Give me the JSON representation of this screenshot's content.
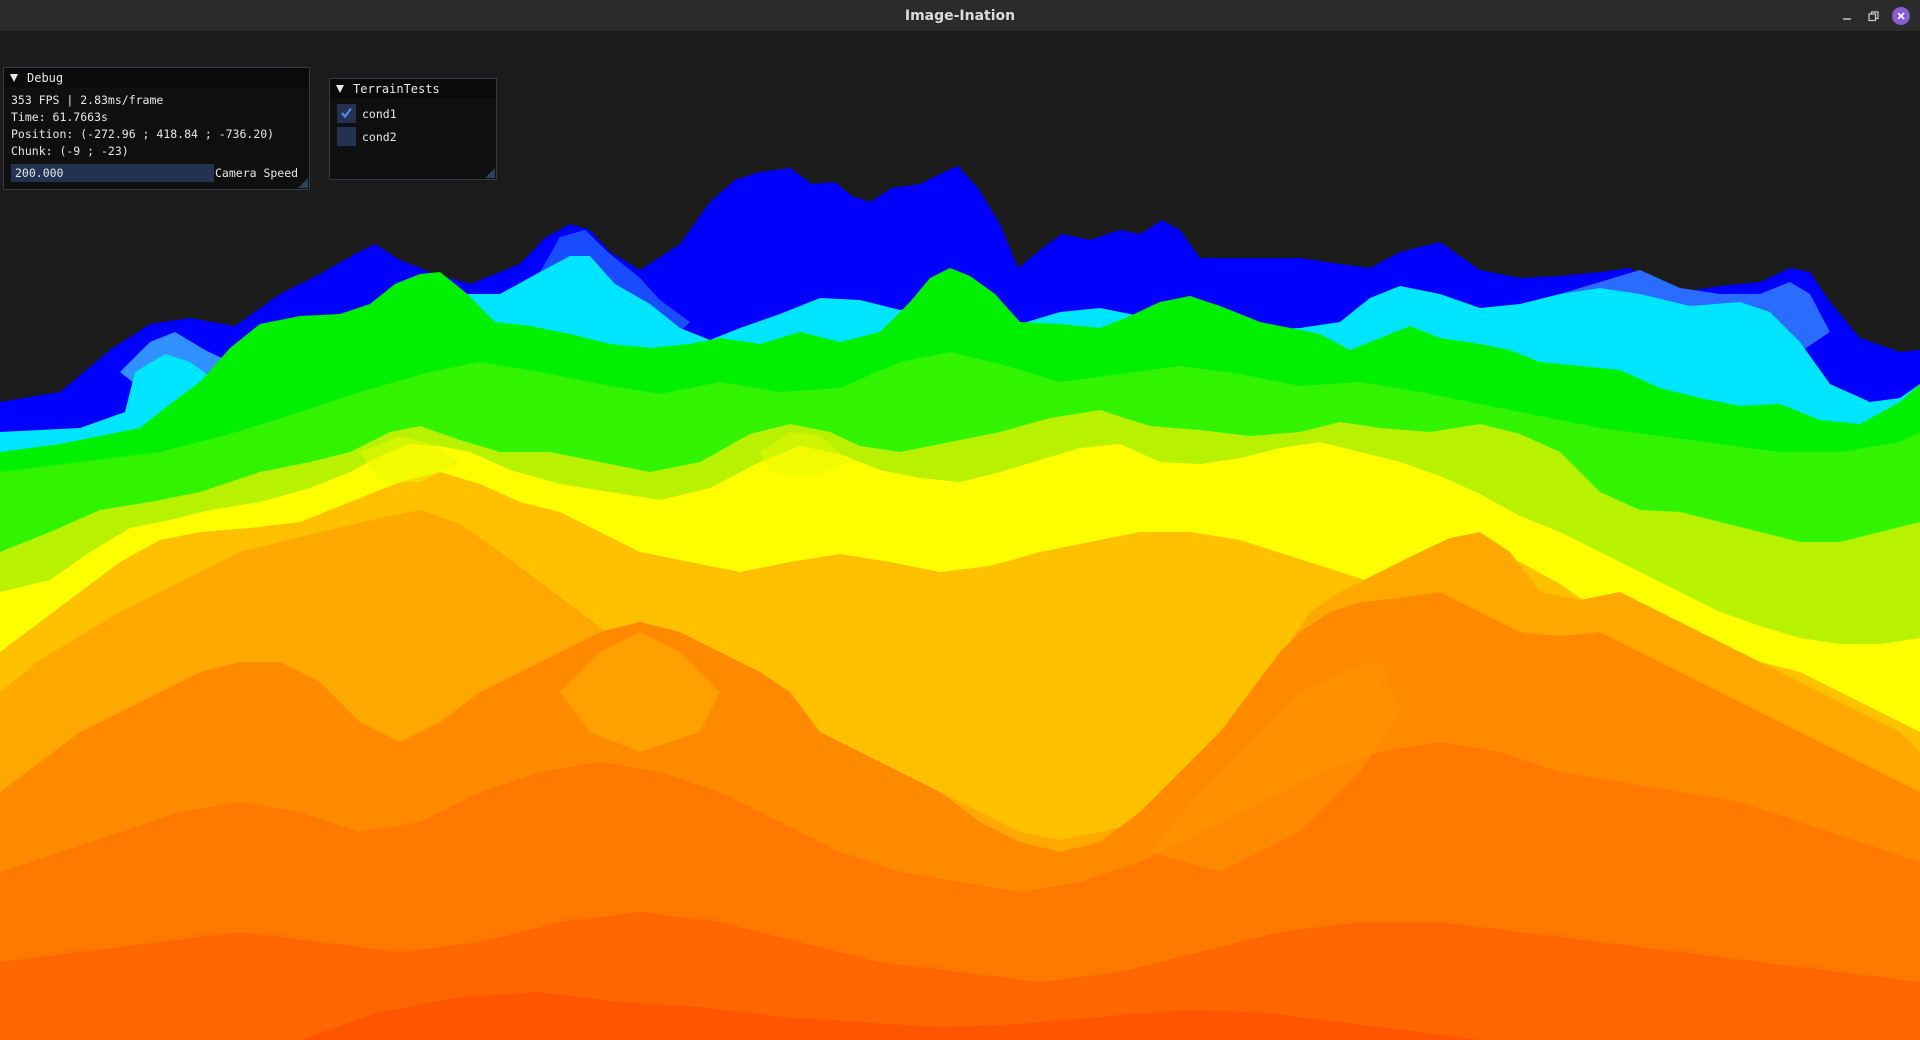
{
  "window": {
    "title": "Image-Ination"
  },
  "debug_panel": {
    "title": "Debug",
    "fps_line": "353 FPS | 2.83ms/frame",
    "time_line": "Time: 61.7663s",
    "position_line": "Position: (-272.96 ; 418.84 ; -736.20)",
    "chunk_line": "Chunk: (-9 ; -23)",
    "camera_speed_value": "200.000",
    "camera_speed_label": "Camera Speed"
  },
  "terrain_panel": {
    "title": "TerrainTests",
    "conditions": [
      {
        "label": "cond1",
        "checked": true
      },
      {
        "label": "cond2",
        "checked": false
      }
    ]
  },
  "colors": {
    "background": "#1b1b1b",
    "titlebar": "#2b2b2b",
    "close_button": "#8a5ad0",
    "panel_bg": "#0f0f0f",
    "widget_bg": "#223250",
    "terrain_gradient": [
      "#0000ff",
      "#00e5ff",
      "#00f000",
      "#b8f200",
      "#ffff00",
      "#ffc000",
      "#ff9000",
      "#ff7000",
      "#ff5a00"
    ]
  },
  "icons": {
    "minimize": "minimize-icon",
    "maximize": "restore-icon",
    "close": "close-icon",
    "collapse": "collapse-arrow-icon",
    "check": "checkmark-icon"
  }
}
